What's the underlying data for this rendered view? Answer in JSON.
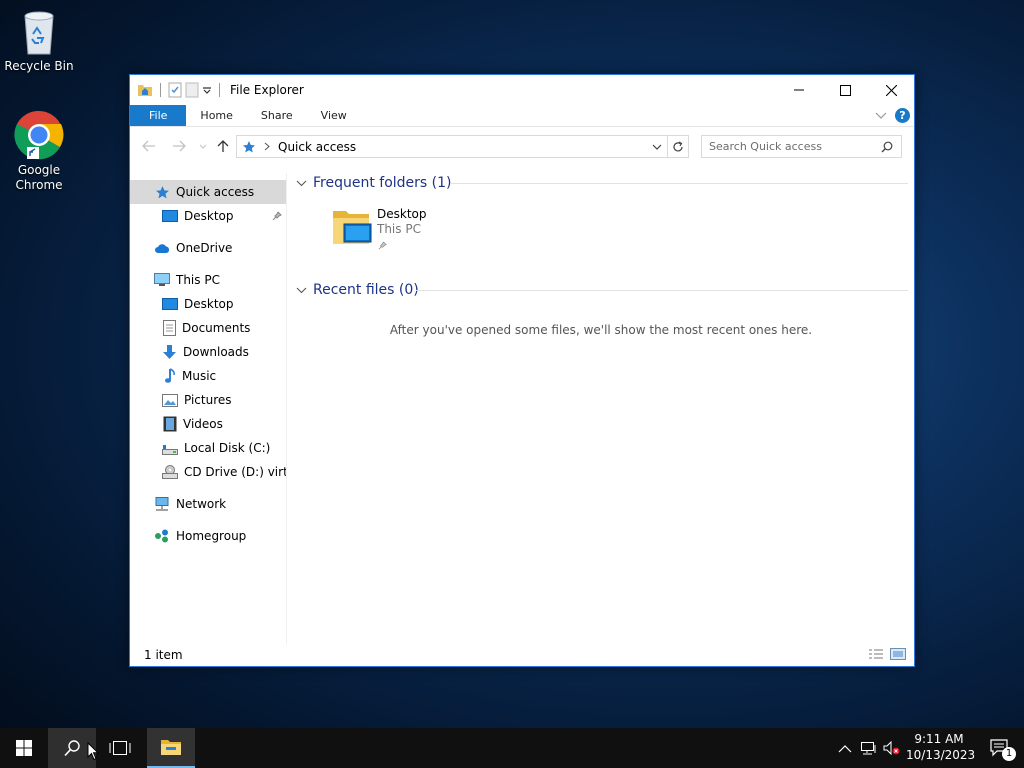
{
  "desktop": {
    "icons": [
      {
        "label": "Recycle Bin"
      },
      {
        "label": "Google Chrome"
      }
    ]
  },
  "window": {
    "title": "File Explorer",
    "ribbon_tabs": [
      "File",
      "Home",
      "Share",
      "View"
    ],
    "address": "Quick access",
    "search_placeholder": "Search Quick access",
    "nav": {
      "quick_access": "Quick access",
      "qa_desktop": "Desktop",
      "onedrive": "OneDrive",
      "this_pc": "This PC",
      "pc_desktop": "Desktop",
      "documents": "Documents",
      "downloads": "Downloads",
      "music": "Music",
      "pictures": "Pictures",
      "videos": "Videos",
      "local_disk": "Local Disk (C:)",
      "cd_drive": "CD Drive (D:) virtio-",
      "network": "Network",
      "homegroup": "Homegroup"
    },
    "content": {
      "frequent_header": "Frequent folders (1)",
      "frequent_item": {
        "name": "Desktop",
        "location": "This PC"
      },
      "recent_header": "Recent files (0)",
      "recent_empty": "After you've opened some files, we'll show the most recent ones here."
    },
    "status": "1 item"
  },
  "taskbar": {
    "time": "9:11 AM",
    "date": "10/13/2023",
    "notification_count": "1"
  },
  "colors": {
    "accent": "#1979ca",
    "group_header": "#1e3287",
    "taskbar": "#101010"
  }
}
